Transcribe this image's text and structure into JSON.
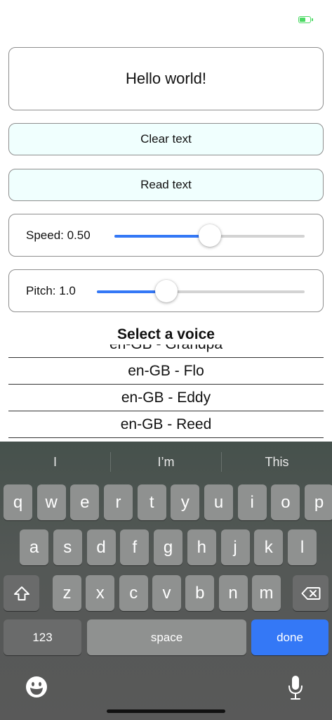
{
  "status": {
    "battery_level": 0.55,
    "battery_color": "#4cd964"
  },
  "text_field": {
    "value": "Hello world!"
  },
  "buttons": {
    "clear_label": "Clear text",
    "read_label": "Read text",
    "accent": "#f0fffe"
  },
  "speed": {
    "label": "Speed: 0.50",
    "value": 0.5,
    "min": 0,
    "max": 1
  },
  "pitch": {
    "label": "Pitch: 1.0",
    "value": 1.0,
    "min": 0.5,
    "max": 2
  },
  "picker": {
    "title": "Select a voice",
    "items": [
      "en-GB - Grandpa",
      "en-GB - Flo",
      "en-GB - Eddy",
      "en-GB - Reed"
    ]
  },
  "keyboard": {
    "suggestions": [
      "I",
      "I’m",
      "This"
    ],
    "row1": [
      "q",
      "w",
      "e",
      "r",
      "t",
      "y",
      "u",
      "i",
      "o",
      "p"
    ],
    "row2": [
      "a",
      "s",
      "d",
      "f",
      "g",
      "h",
      "j",
      "k",
      "l"
    ],
    "row3": [
      "z",
      "x",
      "c",
      "v",
      "b",
      "n",
      "m"
    ],
    "numbers_label": "123",
    "space_label": "space",
    "done_label": "done",
    "accent": "#3478f6",
    "icons": {
      "shift": "shift-icon",
      "backspace": "backspace-icon",
      "emoji": "emoji-icon",
      "mic": "microphone-icon"
    }
  }
}
